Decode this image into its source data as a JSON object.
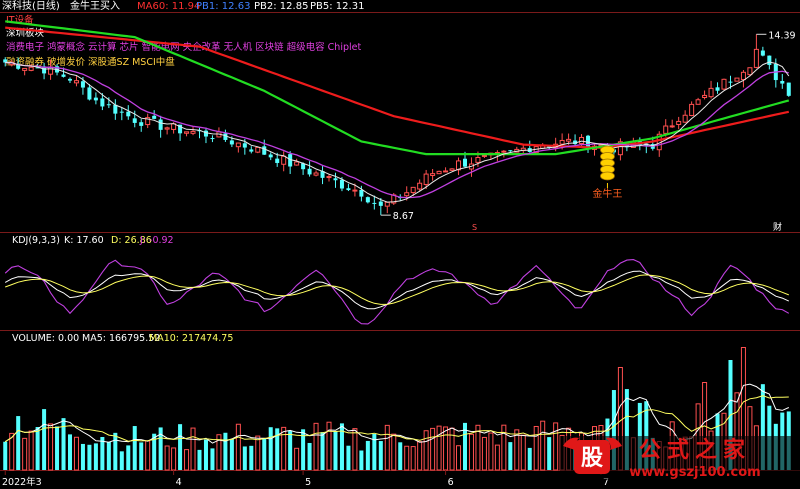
{
  "header": {
    "stock": "深科技(日线)",
    "indicator": "金牛王买入",
    "ma60": "MA60: 11.94",
    "pb1": "PB1: 12.63",
    "pb2": "PB2: 12.85",
    "pb5": "PB5: 12.31"
  },
  "tags": [
    {
      "text": "IT设备",
      "color": "#ff4040"
    },
    {
      "text": "深圳板块",
      "color": "#ffffff"
    },
    {
      "text": "消费电子 鸿蒙概念 云计算 芯片 智能电网 央企改革 无人机 区块链 超级电容 Chiplet",
      "color": "#e040e0"
    },
    {
      "text": "融资融券 破增发价 深股通SZ MSCI中盘",
      "color": "#ffd040"
    }
  ],
  "annotations": {
    "high": "14.39",
    "low": "8.67",
    "signal": "金牛王",
    "mark_s": "S",
    "mark_cai": "财"
  },
  "kdj": {
    "title": "KDJ(9,3,3)",
    "k": "K: 17.60",
    "d": "D: 26.86",
    "j": "J: -0.92"
  },
  "volume": {
    "title": "VOLUME: 0.00",
    "ma5": "MA5: 166795.52",
    "ma10": "MA10: 217474.75"
  },
  "xaxis": {
    "labels": [
      "2022年3",
      "4",
      "5",
      "6",
      "7"
    ]
  },
  "watermark": {
    "logo": "股",
    "title": "公式之家",
    "url": "www.gszj100.com"
  },
  "colors": {
    "up": "#ff5050",
    "down": "#54ffff",
    "ma_red": "#ee1c1c",
    "ma_green": "#22dd22",
    "ma_purple": "#c040e0",
    "ma_white": "#e8e8e8",
    "signal": "#ffd000"
  },
  "chart_data": {
    "type": "candlestick",
    "price_range": [
      8.2,
      15.0
    ],
    "n_bars": 122,
    "anchors_close": [
      [
        0,
        13.5
      ],
      [
        6,
        13.3
      ],
      [
        10,
        13.0
      ],
      [
        14,
        12.3
      ],
      [
        20,
        11.7
      ],
      [
        26,
        11.4
      ],
      [
        32,
        11.2
      ],
      [
        38,
        10.8
      ],
      [
        44,
        10.3
      ],
      [
        50,
        9.8
      ],
      [
        55,
        9.4
      ],
      [
        58,
        8.9
      ],
      [
        62,
        9.4
      ],
      [
        66,
        10.0
      ],
      [
        70,
        10.3
      ],
      [
        76,
        10.5
      ],
      [
        82,
        10.9
      ],
      [
        88,
        11.0
      ],
      [
        94,
        10.8
      ],
      [
        100,
        10.9
      ],
      [
        104,
        11.8
      ],
      [
        108,
        12.4
      ],
      [
        112,
        13.0
      ],
      [
        115,
        13.5
      ],
      [
        116,
        13.9
      ],
      [
        118,
        13.3
      ],
      [
        121,
        12.6
      ]
    ],
    "ma60_anchors": [
      [
        0,
        14.6
      ],
      [
        30,
        14.0
      ],
      [
        60,
        11.8
      ],
      [
        80,
        10.9
      ],
      [
        92,
        10.8
      ],
      [
        100,
        11.0
      ],
      [
        121,
        11.94
      ]
    ],
    "ma_green_anchors": [
      [
        0,
        14.8
      ],
      [
        20,
        14.3
      ],
      [
        40,
        12.6
      ],
      [
        55,
        11.0
      ],
      [
        65,
        10.6
      ],
      [
        85,
        10.6
      ],
      [
        100,
        11.1
      ],
      [
        121,
        12.3
      ]
    ],
    "kdj_anchors": [
      [
        0,
        75
      ],
      [
        5,
        60
      ],
      [
        10,
        30
      ],
      [
        15,
        70
      ],
      [
        20,
        75
      ],
      [
        25,
        40
      ],
      [
        32,
        65
      ],
      [
        40,
        30
      ],
      [
        48,
        70
      ],
      [
        55,
        15
      ],
      [
        62,
        55
      ],
      [
        68,
        65
      ],
      [
        75,
        40
      ],
      [
        82,
        70
      ],
      [
        88,
        30
      ],
      [
        95,
        80
      ],
      [
        100,
        65
      ],
      [
        106,
        30
      ],
      [
        112,
        70
      ],
      [
        121,
        25
      ]
    ],
    "volume_anchors": [
      [
        0,
        0.45
      ],
      [
        20,
        0.28
      ],
      [
        40,
        0.3
      ],
      [
        60,
        0.3
      ],
      [
        70,
        0.32
      ],
      [
        80,
        0.3
      ],
      [
        90,
        0.35
      ],
      [
        95,
        0.55
      ],
      [
        100,
        0.4
      ],
      [
        105,
        0.3
      ],
      [
        110,
        0.6
      ],
      [
        115,
        0.7
      ],
      [
        121,
        0.45
      ]
    ]
  }
}
